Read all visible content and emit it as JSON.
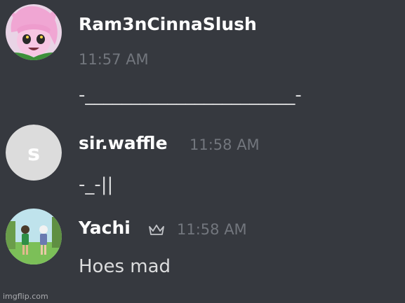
{
  "messages": [
    {
      "author": "Ram3nCinnaSlush",
      "time": "11:57 AM",
      "content": "-_______________________-"
    },
    {
      "author": "sir.waffle",
      "time": "11:58 AM",
      "content": "-_-||",
      "avatar_initial": "s"
    },
    {
      "author": "Yachi",
      "time": "11:58 AM",
      "content": "Hoes mad"
    }
  ],
  "watermark": "imgflip.com",
  "colors": {
    "background": "#36393f",
    "author": "#ffffff",
    "timestamp": "#72767d",
    "message_text": "#dcddde"
  }
}
